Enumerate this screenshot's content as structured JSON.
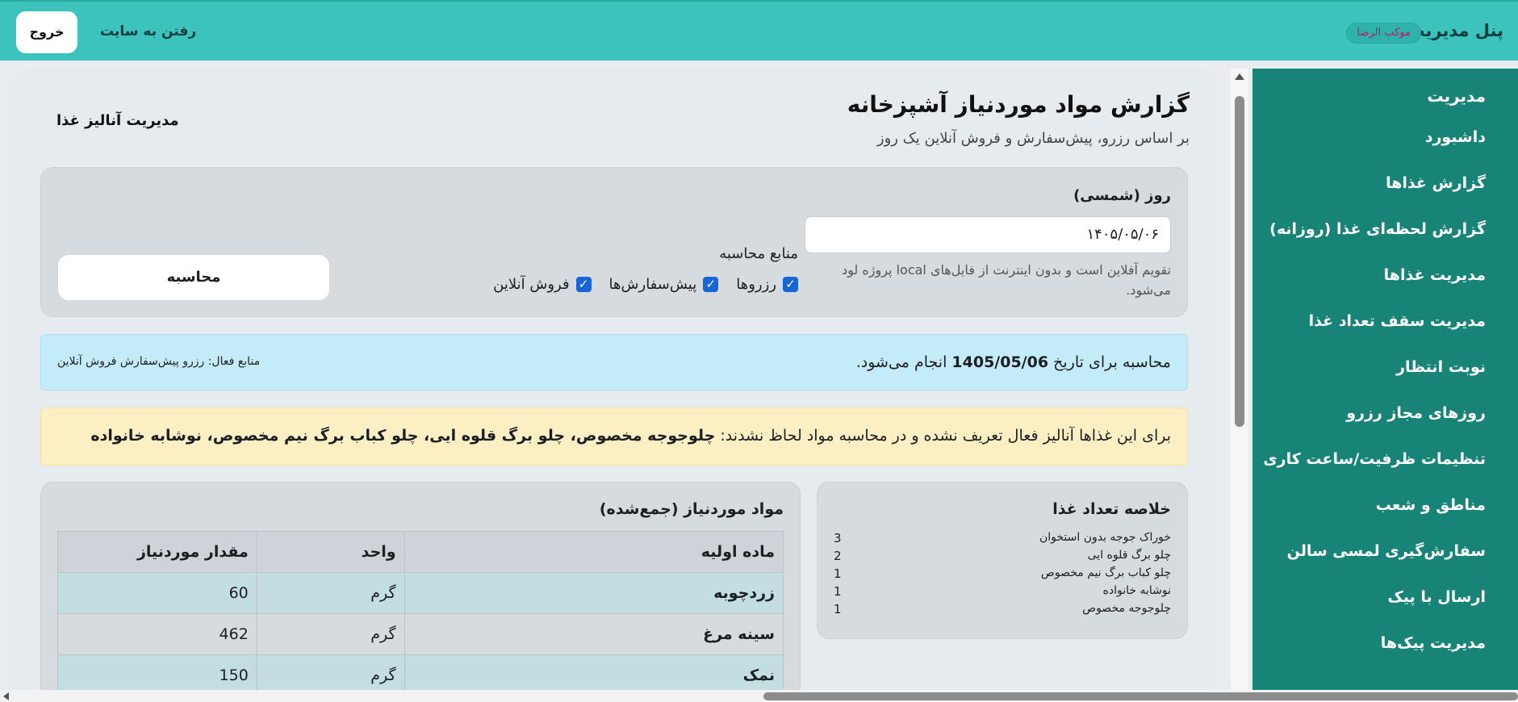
{
  "topbar": {
    "brand": "پنل مدیریت",
    "badge": "موکب الرضا",
    "goto_site": "رفتن به سایت",
    "logout": "خروج"
  },
  "sidebar": {
    "title": "مدیریت",
    "items": [
      "داشبورد",
      "گزارش غذاها",
      "گزارش لحظه‌ای غذا (روزانه)",
      "مدیریت غذاها",
      "مدیریت سقف تعداد غذا",
      "نوبت انتظار",
      "روزهای مجاز رزرو",
      "تنظیمات ظرفیت/ساعت کاری",
      "مناطق و شعب",
      "سفارش‌گیری لمسی سالن",
      "ارسال با پیک",
      "مدیریت پیک‌ها"
    ]
  },
  "page": {
    "title": "گزارش مواد موردنیاز آشپزخانه",
    "subtitle": "بر اساس رزرو، پیش‌سفارش و فروش آنلاین یک روز",
    "food_analysis_link": "مدیریت آنالیز غذا"
  },
  "filter": {
    "date_label": "روز (شمسی)",
    "date_value": "۱۴۰۵/۰۵/۰۶",
    "date_help": "تقویم آفلاین است و بدون اینترنت از فایل‌های local پروژه لود می‌شود.",
    "sources_label": "منابع محاسبه",
    "sources": [
      "رزروها",
      "پیش‌سفارش‌ها",
      "فروش آنلاین"
    ],
    "calculate_button": "محاسبه"
  },
  "info": {
    "prefix": "محاسبه برای تاریخ",
    "date": "1405/05/06",
    "suffix": "انجام می‌شود.",
    "active_sources": "منابع فعال: رزرو پیش‌سفارش فروش آنلاین"
  },
  "warning": {
    "prefix": "برای این غذاها آنالیز فعال تعریف نشده و در محاسبه مواد لحاظ نشدند:",
    "foods": "چلوجوجه مخصوص، چلو برگ قلوه ایی، چلو کباب برگ نیم مخصوص، نوشابه خانواده"
  },
  "summary": {
    "title": "خلاصه تعداد غذا",
    "rows": [
      {
        "name": "خوراک جوجه بدون استخوان",
        "count": "3"
      },
      {
        "name": "چلو برگ قلوه ایی",
        "count": "2"
      },
      {
        "name": "چلو کباب برگ نیم مخصوص",
        "count": "1"
      },
      {
        "name": "نوشابه خانواده",
        "count": "1"
      },
      {
        "name": "چلوجوجه مخصوص",
        "count": "1"
      }
    ]
  },
  "materials": {
    "title": "مواد موردنیاز (جمع‌شده)",
    "headers": [
      "ماده اولیه",
      "واحد",
      "مقدار موردنیاز"
    ],
    "rows": [
      {
        "name": "زردچوبه",
        "unit": "گرم",
        "amount": "60"
      },
      {
        "name": "سینه مرغ",
        "unit": "گرم",
        "amount": "462"
      },
      {
        "name": "نمک",
        "unit": "گرم",
        "amount": "150"
      }
    ]
  },
  "colors": {
    "topbar": "#3cc3bd",
    "sidebar": "#188377",
    "checkbox": "#1766d6",
    "info_bg": "#c4ecf8",
    "warning_bg": "#fdefc4"
  }
}
